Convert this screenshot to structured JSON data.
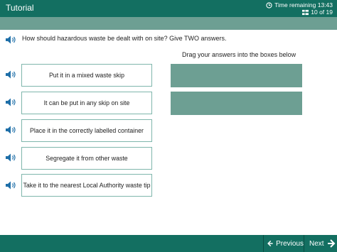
{
  "header": {
    "title": "Tutorial",
    "time_remaining": "Time remaining 13:43",
    "progress": "10 of 19"
  },
  "question": {
    "text": "How should hazardous waste be dealt with on site? Give TWO answers.",
    "instruction": "Drag your answers into the boxes below"
  },
  "options": [
    {
      "label": "Put it in a mixed waste skip"
    },
    {
      "label": "It can be put in any skip on site"
    },
    {
      "label": "Place it in the correctly labelled container"
    },
    {
      "label": "Segregate it from other waste"
    },
    {
      "label": "Take it to the nearest Local Authority waste tip"
    }
  ],
  "footer": {
    "previous_label": "Previous",
    "next_label": "Next"
  },
  "colors": {
    "header_bg": "#136f61",
    "subbar_bg": "#6d9f93",
    "dropbox_bg": "#6d9f93",
    "option_border": "#7fb6ac",
    "speaker_icon": "#1f6fa8"
  },
  "icons": [
    "clock-icon",
    "question-count-icon",
    "speaker-icon",
    "previous-arrow-icon",
    "next-arrow-icon"
  ]
}
